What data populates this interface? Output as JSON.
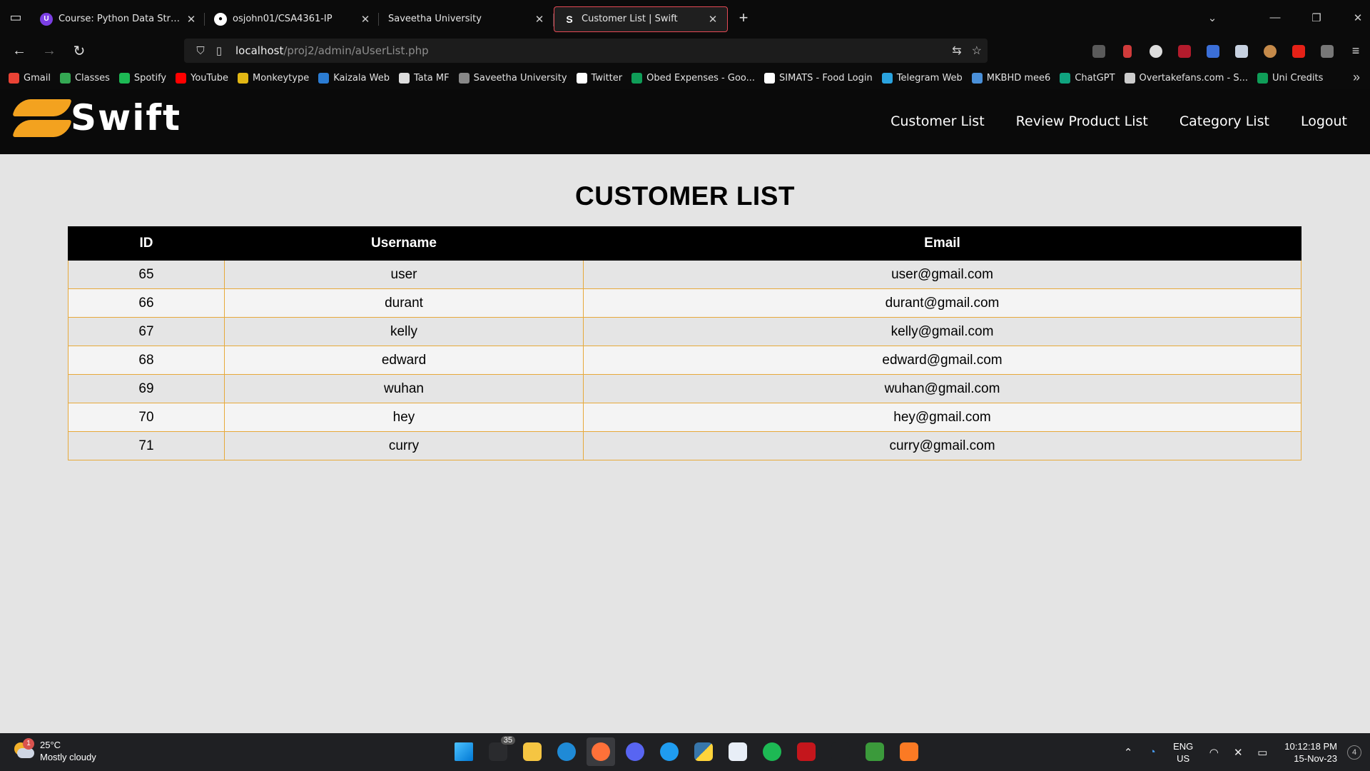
{
  "browser": {
    "tabs": [
      {
        "title": "Course: Python Data Structures",
        "icon": "course-icon",
        "color": "#7b3fe4",
        "active": false
      },
      {
        "title": "osjohn01/CSA4361-IP",
        "icon": "github-icon",
        "color": "#ffffff",
        "active": false
      },
      {
        "title": "Saveetha University",
        "icon": "none",
        "color": "#0b0b0b",
        "active": false
      },
      {
        "title": "Customer List | Swift",
        "icon": "swift-icon",
        "color": "#ffffff",
        "active": true
      }
    ],
    "url_host": "localhost",
    "url_path": "/proj2/admin/aUserList.php",
    "bookmarks": [
      {
        "label": "Gmail",
        "color": "#ea4335"
      },
      {
        "label": "Classes",
        "color": "#34a853"
      },
      {
        "label": "Spotify",
        "color": "#1db954"
      },
      {
        "label": "YouTube",
        "color": "#ff0000"
      },
      {
        "label": "Monkeytype",
        "color": "#e2b714"
      },
      {
        "label": "Kaizala Web",
        "color": "#2b7cd3"
      },
      {
        "label": "Tata MF",
        "color": "#dddddd"
      },
      {
        "label": "Saveetha University",
        "color": "#888888"
      },
      {
        "label": "Twitter",
        "color": "#ffffff"
      },
      {
        "label": "Obed Expenses - Goo...",
        "color": "#0f9d58"
      },
      {
        "label": "SIMATS - Food Login",
        "color": "#ffffff"
      },
      {
        "label": "Telegram Web",
        "color": "#2aa3df"
      },
      {
        "label": "MKBHD mee6",
        "color": "#4a90d9"
      },
      {
        "label": "ChatGPT",
        "color": "#10a37f"
      },
      {
        "label": "Overtakefans.com - S...",
        "color": "#cccccc"
      },
      {
        "label": "Uni Credits",
        "color": "#0f9d58"
      }
    ]
  },
  "site": {
    "logo_text": "Swift",
    "brand_color": "#f3a21f",
    "nav": [
      "Customer List",
      "Review Product List",
      "Category List",
      "Logout"
    ]
  },
  "content": {
    "title": "CUSTOMER LIST",
    "columns": [
      "ID",
      "Username",
      "Email"
    ],
    "rows": [
      {
        "id": "65",
        "username": "user",
        "email": "user@gmail.com"
      },
      {
        "id": "66",
        "username": "durant",
        "email": "durant@gmail.com"
      },
      {
        "id": "67",
        "username": "kelly",
        "email": "kelly@gmail.com"
      },
      {
        "id": "68",
        "username": "edward",
        "email": "edward@gmail.com"
      },
      {
        "id": "69",
        "username": "wuhan",
        "email": "wuhan@gmail.com"
      },
      {
        "id": "70",
        "username": "hey",
        "email": "hey@gmail.com"
      },
      {
        "id": "71",
        "username": "curry",
        "email": "curry@gmail.com"
      }
    ]
  },
  "taskbar": {
    "weather_temp": "25°C",
    "weather_desc": "Mostly cloudy",
    "weather_badge": "1",
    "app_badge": "35",
    "lang_line1": "ENG",
    "lang_line2": "US",
    "time": "10:12:18 PM",
    "date": "15-Nov-23",
    "notif_count": "4"
  }
}
